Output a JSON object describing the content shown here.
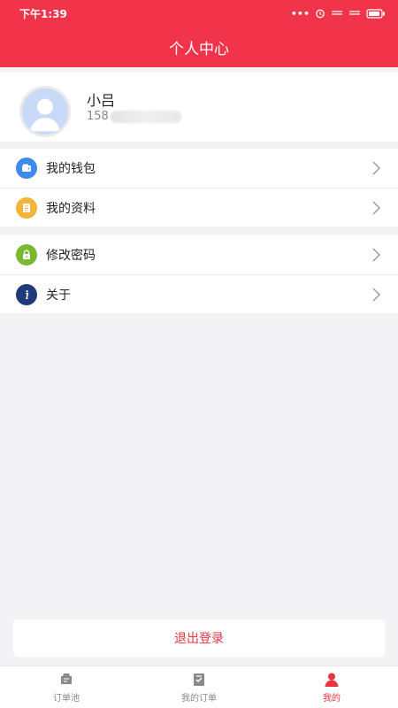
{
  "status_bar": {
    "time": "下午1:39",
    "icons": [
      "dots-icon",
      "alarm-icon",
      "wifi-icon",
      "signal-icon",
      "battery-icon"
    ]
  },
  "header": {
    "title": "个人中心"
  },
  "profile": {
    "name": "小吕",
    "phone": "158"
  },
  "menu_group_1": [
    {
      "label": "我的钱包",
      "icon": "wallet-icon",
      "color": "#3d8ae8"
    },
    {
      "label": "我的资料",
      "icon": "profile-doc-icon",
      "color": "#f2b43a"
    }
  ],
  "menu_group_2": [
    {
      "label": "修改密码",
      "icon": "lock-icon",
      "color": "#7ab832"
    },
    {
      "label": "关于",
      "icon": "info-icon",
      "color": "#1e3a7a"
    }
  ],
  "logout": {
    "label": "退出登录"
  },
  "tabbar": {
    "tabs": [
      {
        "label": "订单池",
        "icon": "order-pool-icon",
        "active": false
      },
      {
        "label": "我的订单",
        "icon": "my-orders-icon",
        "active": false
      },
      {
        "label": "我的",
        "icon": "user-icon",
        "active": true
      }
    ]
  },
  "colors": {
    "brand": "#f2344a",
    "accent_text": "#e8343e",
    "background": "#f3f3f5"
  }
}
